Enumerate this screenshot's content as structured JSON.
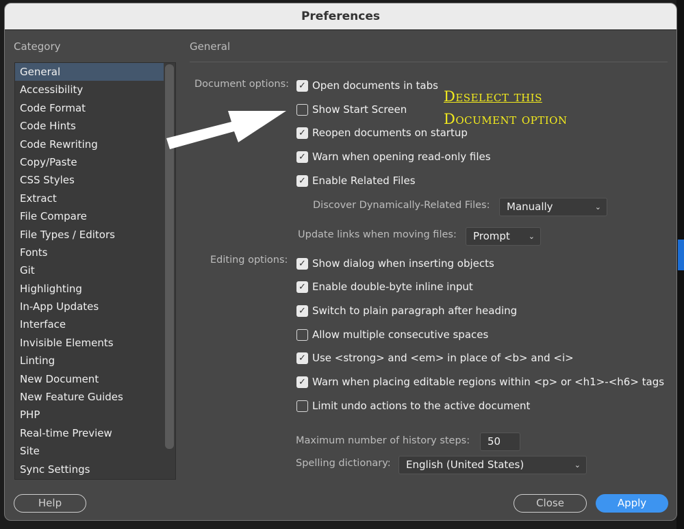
{
  "window": {
    "title": "Preferences"
  },
  "sidebar": {
    "heading": "Category",
    "selected": "General",
    "items": [
      "General",
      "Accessibility",
      "Code Format",
      "Code Hints",
      "Code Rewriting",
      "Copy/Paste",
      "CSS Styles",
      "Extract",
      "File Compare",
      "File Types / Editors",
      "Fonts",
      "Git",
      "Highlighting",
      "In-App Updates",
      "Interface",
      "Invisible Elements",
      "Linting",
      "New Document",
      "New Feature Guides",
      "PHP",
      "Real-time Preview",
      "Site",
      "Sync Settings"
    ]
  },
  "main": {
    "heading": "General",
    "document_options_label": "Document options:",
    "document_options": [
      {
        "label": "Open documents in tabs",
        "checked": true
      },
      {
        "label": "Show Start Screen",
        "checked": false
      },
      {
        "label": "Reopen documents on startup",
        "checked": true
      },
      {
        "label": "Warn when opening read-only files",
        "checked": true
      },
      {
        "label": "Enable Related Files",
        "checked": true
      }
    ],
    "discover_label": "Discover Dynamically-Related Files:",
    "discover_value": "Manually",
    "update_links_label": "Update links when moving files:",
    "update_links_value": "Prompt",
    "editing_options_label": "Editing options:",
    "editing_options": [
      {
        "label": "Show dialog when inserting objects",
        "checked": true
      },
      {
        "label": "Enable double-byte inline input",
        "checked": true
      },
      {
        "label": "Switch to plain paragraph after heading",
        "checked": true
      },
      {
        "label": "Allow multiple consecutive spaces",
        "checked": false
      },
      {
        "label": "Use <strong> and <em> in place of <b> and <i>",
        "checked": true
      },
      {
        "label": "Warn when placing editable regions within <p> or <h1>-<h6> tags",
        "checked": true
      },
      {
        "label": "Limit undo actions to the active document",
        "checked": false
      }
    ],
    "history_label": "Maximum number of history steps:",
    "history_value": "50",
    "spelling_label": "Spelling dictionary:",
    "spelling_value": "English (United States)"
  },
  "annotation": {
    "line1": "Deselect this",
    "line2": "Document option",
    "color": "#f2ea1e"
  },
  "footer": {
    "help": "Help",
    "close": "Close",
    "apply": "Apply"
  },
  "colors": {
    "accent": "#3d94f0",
    "selection": "#44576d"
  }
}
